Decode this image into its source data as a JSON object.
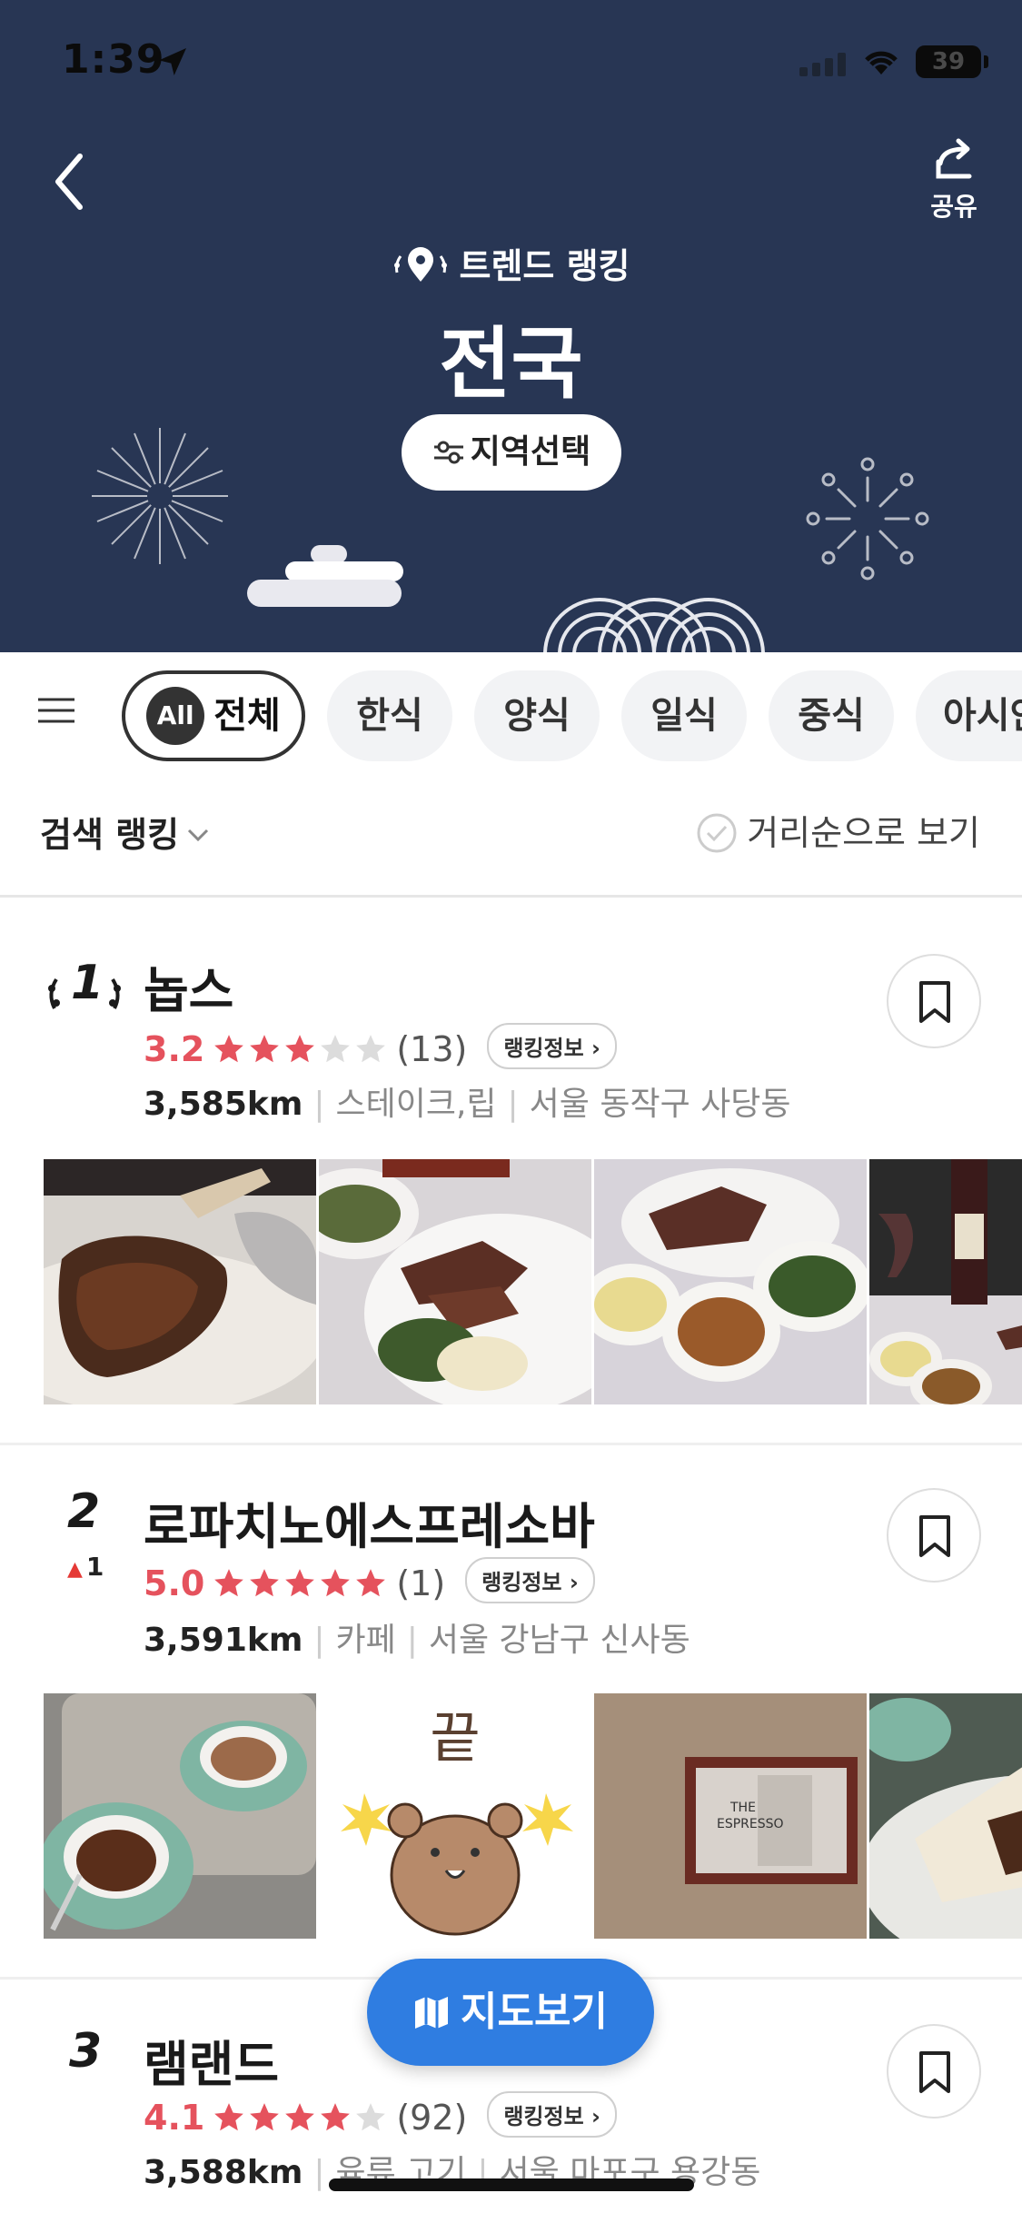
{
  "status_bar": {
    "time": "1:39",
    "battery": "39"
  },
  "header": {
    "share_label": "공유",
    "subtitle": "트렌드 랭킹",
    "title": "전국",
    "region_button": "지역선택"
  },
  "tabs": [
    {
      "icon_text": "All",
      "label": "전체",
      "active": true
    },
    {
      "label": "한식"
    },
    {
      "label": "양식"
    },
    {
      "label": "일식"
    },
    {
      "label": "중식"
    },
    {
      "label": "아시안"
    }
  ],
  "filters": {
    "rank_type": "검색 랭킹",
    "distance_toggle": "거리순으로 보기"
  },
  "restaurants": [
    {
      "rank": "1",
      "name": "놉스",
      "rating": "3.2",
      "stars": 3,
      "reviews": "(13)",
      "rank_info": "랭킹정보",
      "distance": "3,585km",
      "category": "스테이크,립",
      "address": "서울 동작구 사당동"
    },
    {
      "rank": "2",
      "rank_change": "1",
      "name": "로파치노에스프레소바",
      "rating": "5.0",
      "stars": 5,
      "reviews": "(1)",
      "rank_info": "랭킹정보",
      "distance": "3,591km",
      "category": "카페",
      "address": "서울 강남구 신사동"
    },
    {
      "rank": "3",
      "name": "램랜드",
      "rating": "4.1",
      "stars": 4,
      "reviews": "(92)",
      "rank_info": "랭킹정보",
      "distance": "3,588km",
      "category": "육류,고기",
      "address": "서울 마포구 용강동"
    }
  ],
  "photo_caption_text": "끝",
  "map_button": "지도보기",
  "colors": {
    "header_bg": "#283654",
    "accent_red": "#e5525d",
    "map_blue": "#2f7de1"
  }
}
